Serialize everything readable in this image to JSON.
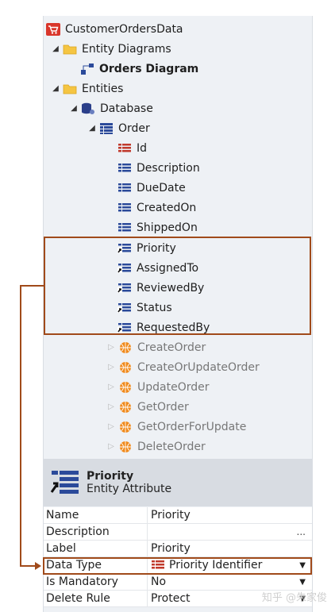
{
  "tree": {
    "root": "CustomerOrdersData",
    "entity_diagrams": "Entity Diagrams",
    "orders_diagram": "Orders Diagram",
    "entities": "Entities",
    "database": "Database",
    "order": "Order",
    "attributes": [
      "Id",
      "Description",
      "DueDate",
      "CreatedOn",
      "ShippedOn"
    ],
    "ref_attributes": [
      "Priority",
      "AssignedTo",
      "ReviewedBy",
      "Status",
      "RequestedBy"
    ],
    "actions": [
      "CreateOrder",
      "CreateOrUpdateOrder",
      "UpdateOrder",
      "GetOrder",
      "GetOrderForUpdate",
      "DeleteOrder"
    ]
  },
  "selected": {
    "title": "Priority",
    "subtitle": "Entity Attribute"
  },
  "properties": [
    {
      "name": "Name",
      "value": "Priority"
    },
    {
      "name": "Description",
      "value": ""
    },
    {
      "name": "Label",
      "value": "Priority"
    },
    {
      "name": "Data Type",
      "value": "Priority Identifier"
    },
    {
      "name": "Is Mandatory",
      "value": "No"
    },
    {
      "name": "Delete Rule",
      "value": "Protect"
    }
  ],
  "description_ellipsis": "...",
  "watermark": "知乎 @朱家俊",
  "colors": {
    "highlight_border": "#a04a1a",
    "panel_bg": "#eef1f5",
    "header_bg": "#d8dce2",
    "attr_icon": "#2b4a9a",
    "action_icon": "#f08a1c"
  }
}
